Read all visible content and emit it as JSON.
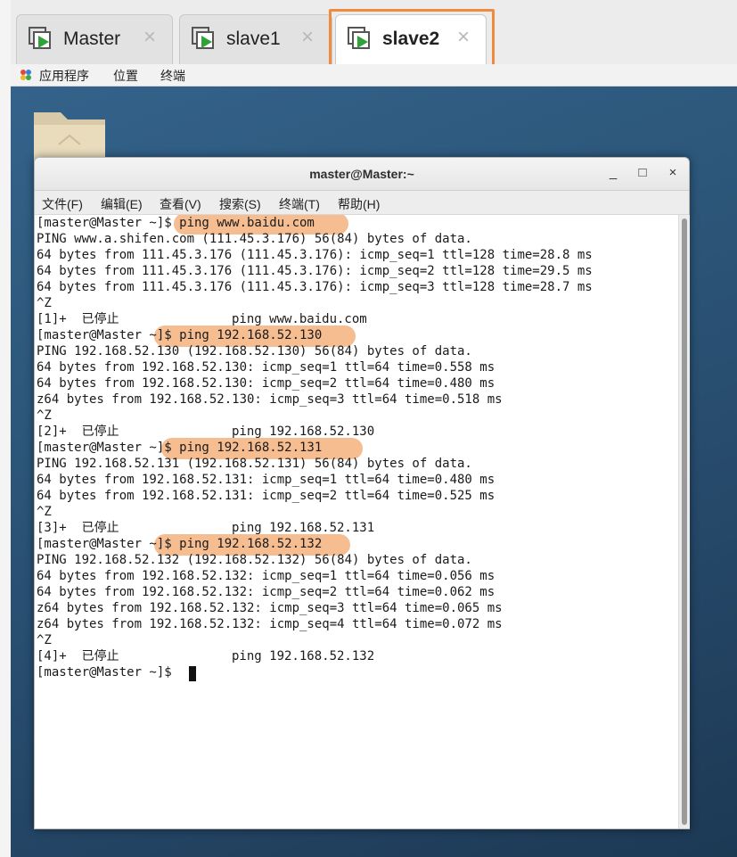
{
  "tabs": [
    {
      "label": "Master",
      "close": "×"
    },
    {
      "label": "slave1",
      "close": "×"
    },
    {
      "label": "slave2",
      "close": "×",
      "active": true
    }
  ],
  "desktop_menu": [
    "应用程序",
    "位置",
    "终端"
  ],
  "terminal": {
    "title": "master@Master:~",
    "window_buttons": {
      "minimize": "_",
      "maximize": "□",
      "close": "×"
    },
    "menu": [
      "文件(F)",
      "编辑(E)",
      "查看(V)",
      "搜索(S)",
      "终端(T)",
      "帮助(H)"
    ],
    "lines": [
      "[master@Master ~]$ ping www.baidu.com",
      "PING www.a.shifen.com (111.45.3.176) 56(84) bytes of data.",
      "64 bytes from 111.45.3.176 (111.45.3.176): icmp_seq=1 ttl=128 time=28.8 ms",
      "64 bytes from 111.45.3.176 (111.45.3.176): icmp_seq=2 ttl=128 time=29.5 ms",
      "64 bytes from 111.45.3.176 (111.45.3.176): icmp_seq=3 ttl=128 time=28.7 ms",
      "^Z",
      "[1]+  已停止               ping www.baidu.com",
      "[master@Master ~]$ ping 192.168.52.130",
      "PING 192.168.52.130 (192.168.52.130) 56(84) bytes of data.",
      "64 bytes from 192.168.52.130: icmp_seq=1 ttl=64 time=0.558 ms",
      "64 bytes from 192.168.52.130: icmp_seq=2 ttl=64 time=0.480 ms",
      "z64 bytes from 192.168.52.130: icmp_seq=3 ttl=64 time=0.518 ms",
      "^Z",
      "[2]+  已停止               ping 192.168.52.130",
      "[master@Master ~]$ ping 192.168.52.131",
      "PING 192.168.52.131 (192.168.52.131) 56(84) bytes of data.",
      "64 bytes from 192.168.52.131: icmp_seq=1 ttl=64 time=0.480 ms",
      "64 bytes from 192.168.52.131: icmp_seq=2 ttl=64 time=0.525 ms",
      "^Z",
      "[3]+  已停止               ping 192.168.52.131",
      "[master@Master ~]$ ping 192.168.52.132",
      "PING 192.168.52.132 (192.168.52.132) 56(84) bytes of data.",
      "64 bytes from 192.168.52.132: icmp_seq=1 ttl=64 time=0.056 ms",
      "64 bytes from 192.168.52.132: icmp_seq=2 ttl=64 time=0.062 ms",
      "z64 bytes from 192.168.52.132: icmp_seq=3 ttl=64 time=0.065 ms",
      "z64 bytes from 192.168.52.132: icmp_seq=4 ttl=64 time=0.072 ms",
      "^Z",
      "[4]+  已停止               ping 192.168.52.132",
      "[master@Master ~]$ "
    ]
  },
  "colors": {
    "highlight": "#f6b98a",
    "tab_outline": "#f08a3c",
    "vm_icon_green": "#2fa33a"
  }
}
